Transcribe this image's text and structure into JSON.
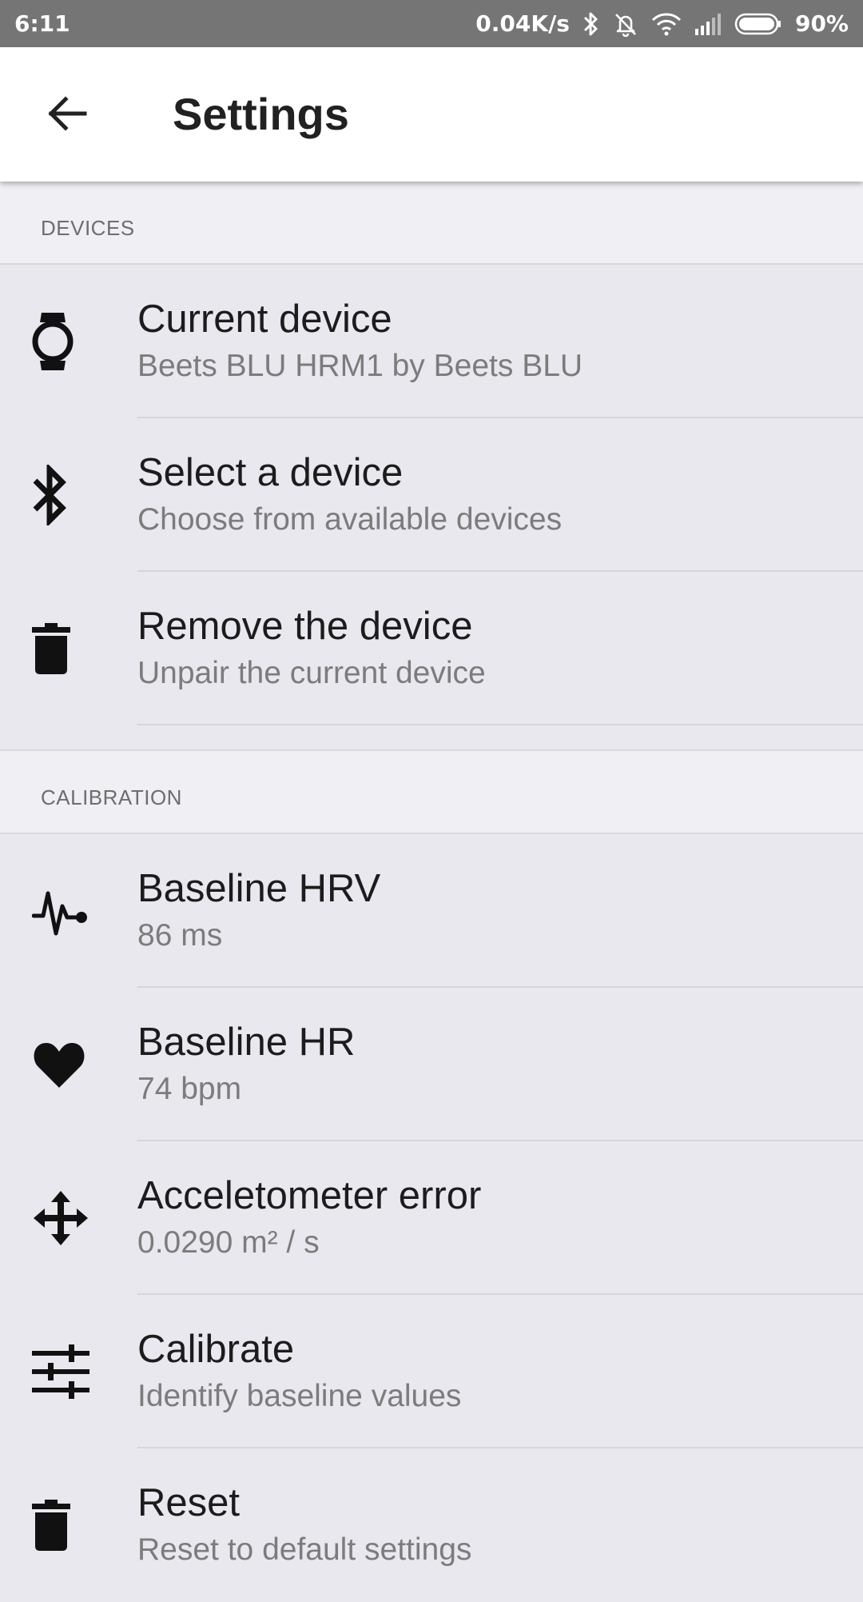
{
  "status_bar": {
    "time": "6:11",
    "net_speed": "0.04K/s",
    "battery": "90%",
    "icons": [
      "bluetooth-icon",
      "bell-off-icon",
      "wifi-icon",
      "signal-icon",
      "battery-icon"
    ]
  },
  "app_bar": {
    "title": "Settings",
    "back_icon": "arrow-back-icon"
  },
  "sections": [
    {
      "header": "DEVICES",
      "items": [
        {
          "label": "Current device",
          "sub": "Beets BLU HRM1 by Beets BLU",
          "icon": "watch-icon"
        },
        {
          "label": "Select a device",
          "sub": "Choose from available devices",
          "icon": "bluetooth-icon"
        },
        {
          "label": "Remove the device",
          "sub": "Unpair the current device",
          "icon": "trash-icon"
        }
      ]
    },
    {
      "header": "CALIBRATION",
      "items": [
        {
          "label": "Baseline HRV",
          "sub": "86 ms",
          "icon": "pulse-icon"
        },
        {
          "label": "Baseline HR",
          "sub": "74 bpm",
          "icon": "heart-icon"
        },
        {
          "label": "Acceletometer error",
          "sub": "0.0290 m² / s",
          "icon": "move-arrows-icon"
        },
        {
          "label": "Calibrate",
          "sub": "Identify baseline values",
          "icon": "sliders-icon"
        },
        {
          "label": "Reset",
          "sub": "Reset to default settings",
          "icon": "trash-icon"
        }
      ]
    }
  ],
  "colors": {
    "status_bar": "#757575",
    "app_bar": "#ffffff",
    "background": "#e9e8ee",
    "section_header_bg": "#efeff4",
    "primary_text": "#1c1c1c",
    "secondary_text": "#7c7c7c"
  }
}
